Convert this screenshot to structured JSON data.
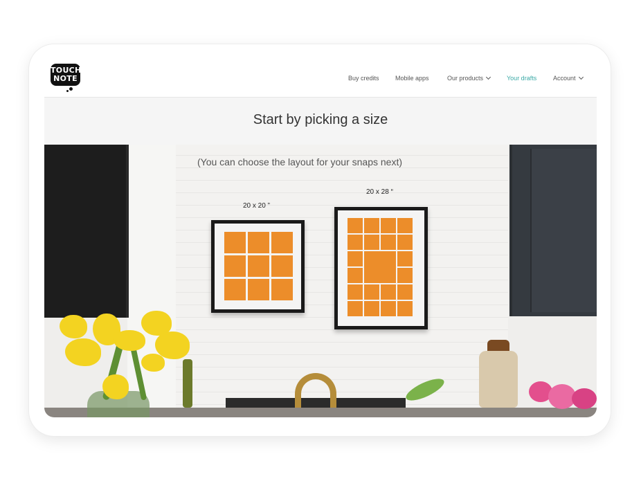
{
  "brand": {
    "logo_text": "TOUCH NOTE",
    "logo_line1": "TOUCH",
    "logo_line2": "NOTE",
    "logo_bg": "#111111"
  },
  "nav": {
    "buy_credits": "Buy credits",
    "mobile_apps": "Mobile apps",
    "our_products": "Our products",
    "your_drafts": "Your drafts",
    "account": "Account",
    "active_color": "#3aa9a6"
  },
  "page": {
    "title": "Start by picking a size",
    "subtitle": "(You can choose the layout for your snaps next)"
  },
  "sizes": [
    {
      "label": "20 x 20 ”",
      "grid": "3x3"
    },
    {
      "label": "20 x 28 “",
      "grid": "4x6 with large center"
    }
  ],
  "colors": {
    "photo_cell": "#ec8d2a",
    "frame": "#1a1a1a",
    "mat": "#f4f4f4"
  }
}
